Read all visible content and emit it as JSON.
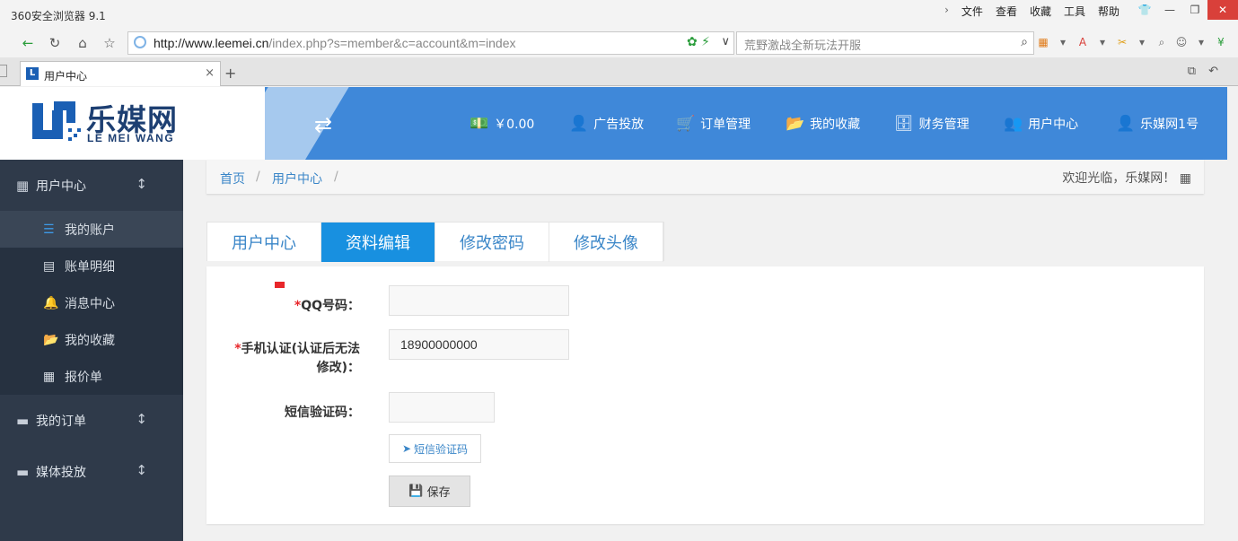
{
  "browser": {
    "app_title": "360安全浏览器 9.1",
    "menu": [
      "文件",
      "查看",
      "收藏",
      "工具",
      "帮助"
    ],
    "url_host": "http://www.leemei.cn",
    "url_path": "/index.php?s=member&c=account&m=index",
    "search_placeholder": "荒野激战全新玩法开服",
    "tab_title": "用户中心"
  },
  "site": {
    "logo_cn": "乐媒网",
    "logo_en": "LE MEI WANG",
    "brand_color": "#3f88d9",
    "nav": {
      "balance": "￥0.00",
      "ads": "广告投放",
      "orders": "订单管理",
      "favorites": "我的收藏",
      "finance": "财务管理",
      "user_center": "用户中心",
      "username": "乐媒网1号"
    }
  },
  "sidebar": {
    "group_user": "用户中心",
    "items": {
      "account": "我的账户",
      "bills": "账单明细",
      "messages": "消息中心",
      "favorites": "我的收藏",
      "quote": "报价单"
    },
    "group_orders": "我的订单",
    "group_media": "媒体投放"
  },
  "breadcrumb": {
    "home": "首页",
    "current": "用户中心",
    "welcome": "欢迎光临，乐媒网！"
  },
  "tabs": {
    "user_center": "用户中心",
    "edit_profile": "资料编辑",
    "change_password": "修改密码",
    "change_avatar": "修改头像"
  },
  "form": {
    "required_mark": "*",
    "qq_label": "QQ号码：",
    "qq_value": "",
    "phone_label_1": "手机认证(认证后无法",
    "phone_label_2": "修改)：",
    "phone_value": "18900000000",
    "sms_label": "短信验证码：",
    "sms_value": "",
    "sms_button": "短信验证码",
    "save_button": "保存"
  }
}
